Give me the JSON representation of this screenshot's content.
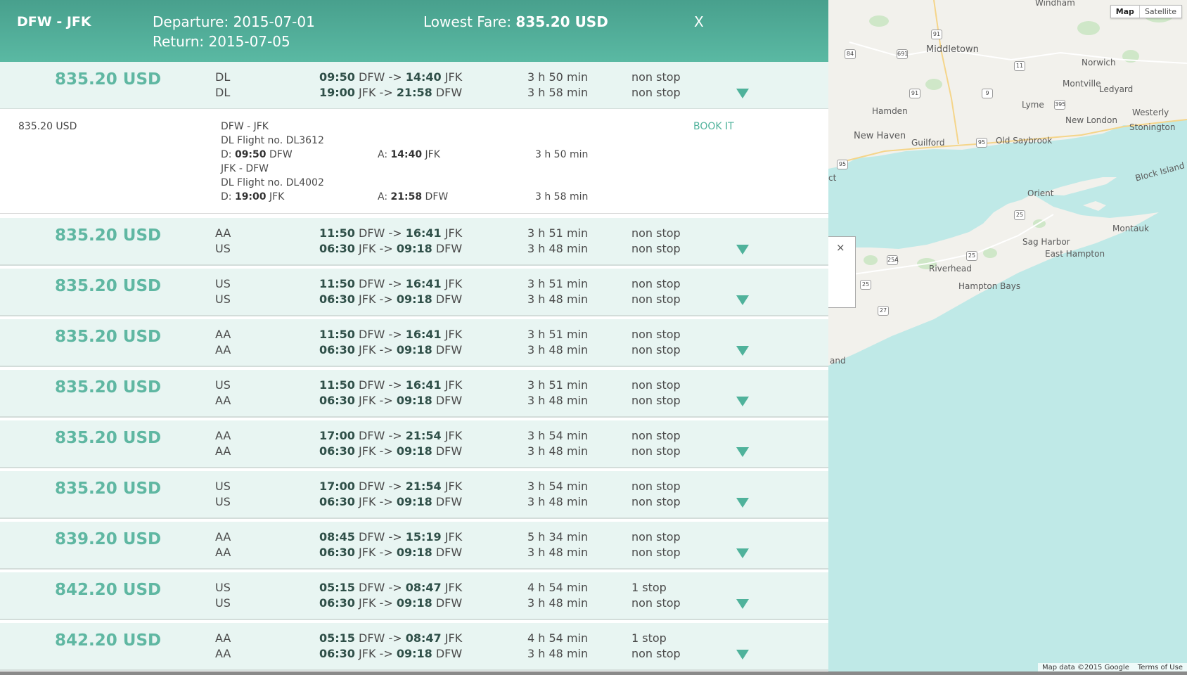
{
  "header": {
    "route": "DFW - JFK",
    "departure": "Departure: 2015-07-01",
    "return": "Return: 2015-07-05",
    "lowest_fare_label": "Lowest Fare:",
    "lowest_fare_value": "835.20 USD",
    "close": "X"
  },
  "results": [
    {
      "price": "835.20 USD",
      "out": {
        "airline": "DL",
        "dep": "09:50",
        "from": "DFW",
        "arr": "14:40",
        "to": "JFK",
        "duration": "3 h 50 min",
        "stops": "non stop"
      },
      "ret": {
        "airline": "DL",
        "dep": "19:00",
        "from": "JFK",
        "arr": "21:58",
        "to": "DFW",
        "duration": "3 h 58 min",
        "stops": "non stop"
      }
    },
    {
      "price": "835.20 USD",
      "out": {
        "airline": "AA",
        "dep": "11:50",
        "from": "DFW",
        "arr": "16:41",
        "to": "JFK",
        "duration": "3 h 51 min",
        "stops": "non stop"
      },
      "ret": {
        "airline": "US",
        "dep": "06:30",
        "from": "JFK",
        "arr": "09:18",
        "to": "DFW",
        "duration": "3 h 48 min",
        "stops": "non stop"
      }
    },
    {
      "price": "835.20 USD",
      "out": {
        "airline": "US",
        "dep": "11:50",
        "from": "DFW",
        "arr": "16:41",
        "to": "JFK",
        "duration": "3 h 51 min",
        "stops": "non stop"
      },
      "ret": {
        "airline": "US",
        "dep": "06:30",
        "from": "JFK",
        "arr": "09:18",
        "to": "DFW",
        "duration": "3 h 48 min",
        "stops": "non stop"
      }
    },
    {
      "price": "835.20 USD",
      "out": {
        "airline": "AA",
        "dep": "11:50",
        "from": "DFW",
        "arr": "16:41",
        "to": "JFK",
        "duration": "3 h 51 min",
        "stops": "non stop"
      },
      "ret": {
        "airline": "AA",
        "dep": "06:30",
        "from": "JFK",
        "arr": "09:18",
        "to": "DFW",
        "duration": "3 h 48 min",
        "stops": "non stop"
      }
    },
    {
      "price": "835.20 USD",
      "out": {
        "airline": "US",
        "dep": "11:50",
        "from": "DFW",
        "arr": "16:41",
        "to": "JFK",
        "duration": "3 h 51 min",
        "stops": "non stop"
      },
      "ret": {
        "airline": "AA",
        "dep": "06:30",
        "from": "JFK",
        "arr": "09:18",
        "to": "DFW",
        "duration": "3 h 48 min",
        "stops": "non stop"
      }
    },
    {
      "price": "835.20 USD",
      "out": {
        "airline": "AA",
        "dep": "17:00",
        "from": "DFW",
        "arr": "21:54",
        "to": "JFK",
        "duration": "3 h 54 min",
        "stops": "non stop"
      },
      "ret": {
        "airline": "AA",
        "dep": "06:30",
        "from": "JFK",
        "arr": "09:18",
        "to": "DFW",
        "duration": "3 h 48 min",
        "stops": "non stop"
      }
    },
    {
      "price": "835.20 USD",
      "out": {
        "airline": "US",
        "dep": "17:00",
        "from": "DFW",
        "arr": "21:54",
        "to": "JFK",
        "duration": "3 h 54 min",
        "stops": "non stop"
      },
      "ret": {
        "airline": "US",
        "dep": "06:30",
        "from": "JFK",
        "arr": "09:18",
        "to": "DFW",
        "duration": "3 h 48 min",
        "stops": "non stop"
      }
    },
    {
      "price": "839.20 USD",
      "out": {
        "airline": "AA",
        "dep": "08:45",
        "from": "DFW",
        "arr": "15:19",
        "to": "JFK",
        "duration": "5 h 34 min",
        "stops": "non stop"
      },
      "ret": {
        "airline": "AA",
        "dep": "06:30",
        "from": "JFK",
        "arr": "09:18",
        "to": "DFW",
        "duration": "3 h 48 min",
        "stops": "non stop"
      }
    },
    {
      "price": "842.20 USD",
      "out": {
        "airline": "US",
        "dep": "05:15",
        "from": "DFW",
        "arr": "08:47",
        "to": "JFK",
        "duration": "4 h 54 min",
        "stops": "1 stop"
      },
      "ret": {
        "airline": "US",
        "dep": "06:30",
        "from": "JFK",
        "arr": "09:18",
        "to": "DFW",
        "duration": "3 h 48 min",
        "stops": "non stop"
      }
    },
    {
      "price": "842.20 USD",
      "out": {
        "airline": "AA",
        "dep": "05:15",
        "from": "DFW",
        "arr": "08:47",
        "to": "JFK",
        "duration": "4 h 54 min",
        "stops": "1 stop"
      },
      "ret": {
        "airline": "AA",
        "dep": "06:30",
        "from": "JFK",
        "arr": "09:18",
        "to": "DFW",
        "duration": "3 h 48 min",
        "stops": "non stop"
      }
    }
  ],
  "details": {
    "price": "835.20 USD",
    "book": "BOOK IT",
    "segments": [
      {
        "route": "DFW - JFK",
        "flight": "DL Flight no. DL3612",
        "d_label": "D:",
        "d_time": "09:50",
        "d_city": "DFW",
        "a_label": "A:",
        "a_time": "14:40",
        "a_city": "JFK",
        "duration": "3 h 50 min"
      },
      {
        "route": "JFK - DFW",
        "flight": "DL Flight no. DL4002",
        "d_label": "D:",
        "d_time": "19:00",
        "d_city": "JFK",
        "a_label": "A:",
        "a_time": "21:58",
        "a_city": "DFW",
        "duration": "3 h 58 min"
      }
    ]
  },
  "map": {
    "type_map": "Map",
    "type_satellite": "Satellite",
    "popup_close": "×",
    "attribution": "Map data ©2015 Google",
    "terms": "Terms of Use",
    "colors": {
      "land": "#f2f1ec",
      "water": "#bfe9e7",
      "park": "#cfe7c8"
    },
    "labels": [
      "Windham",
      "Middletown",
      "Norwich",
      "Montville",
      "Ledyard",
      "Hamden",
      "Lyme",
      "New London",
      "Westerly",
      "Stonington",
      "New Haven",
      "Guilford",
      "Old Saybrook",
      "Block Island Sou",
      "Orient",
      "Montauk",
      "Sag Harbor",
      "East Hampton",
      "Riverhead",
      "Hampton Bays",
      "ct",
      "and"
    ],
    "shields": [
      "91",
      "84",
      "691",
      "11",
      "9",
      "91",
      "395",
      "95",
      "95",
      "25",
      "25A",
      "25",
      "25",
      "27",
      "95"
    ]
  }
}
